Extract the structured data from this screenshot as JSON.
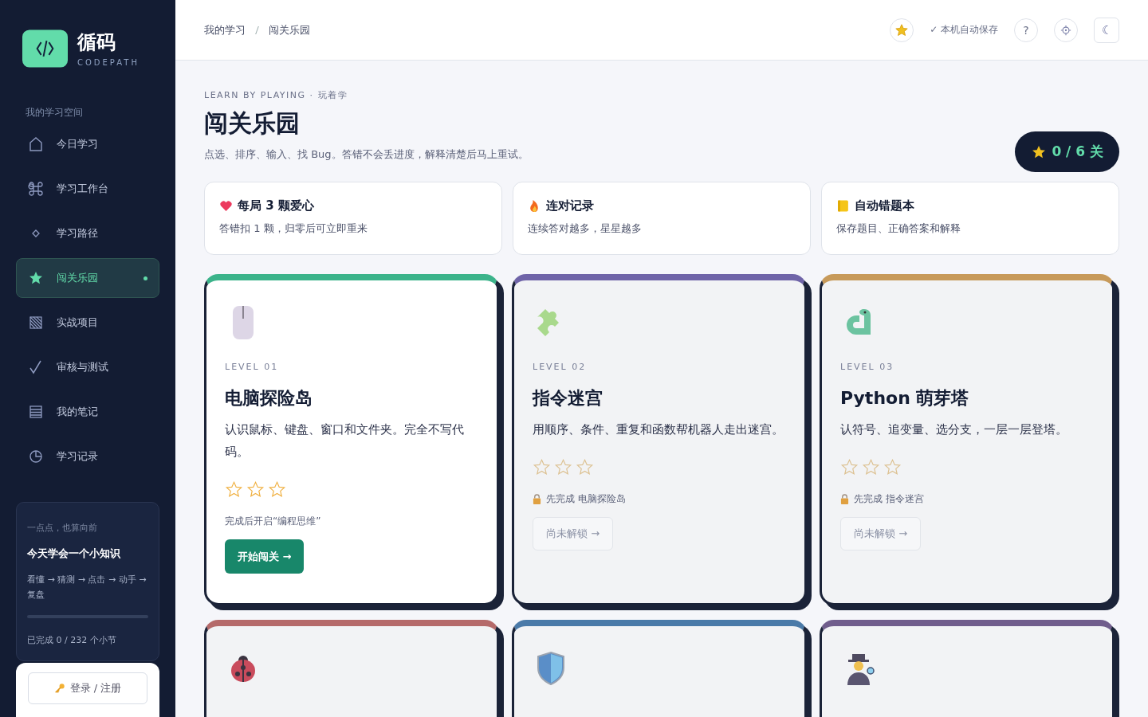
{
  "brand": {
    "name": "循码",
    "sub": "CODEPATH"
  },
  "sidebar": {
    "section": "我的学习空间",
    "items": [
      {
        "label": "今日学习",
        "selected": false
      },
      {
        "label": "学习工作台",
        "selected": false
      },
      {
        "label": "学习路径",
        "selected": false
      },
      {
        "label": "闯关乐园",
        "selected": true
      },
      {
        "label": "实战项目",
        "selected": false
      },
      {
        "label": "审核与测试",
        "selected": false
      },
      {
        "label": "我的笔记",
        "selected": false
      },
      {
        "label": "学习记录",
        "selected": false
      }
    ],
    "progress_card": {
      "eyebrow": "一点点，也算向前",
      "title": "今天学会一个小知识",
      "steps": "看懂 → 猜测 → 点击 → 动手 → 复盘",
      "level": 0,
      "caption": "已完成 0 / 232 个小节"
    },
    "login": "登录 / 注册"
  },
  "breadcrumb": [
    "我的学习",
    "闯关乐园"
  ],
  "header": {
    "saved": "✓ 本机自动保存",
    "help": "?",
    "theme": "☾"
  },
  "hero": {
    "eyebrow": "LEARN BY PLAYING · 玩着学",
    "title": "闯关乐园",
    "subtitle": "点选、排序、输入、找 Bug。答错不会丢进度，解释清楚后马上重试。",
    "score": "0 / 6 关"
  },
  "features": [
    {
      "title": "每局 3 颗爱心",
      "desc": "答错扣 1 颗，归零后可立即重来"
    },
    {
      "title": "连对记录",
      "desc": "连续答对越多，星星越多"
    },
    {
      "title": "自动错题本",
      "desc": "保存题目、正确答案和解释"
    }
  ],
  "levels": [
    {
      "level": "LEVEL 01",
      "title": "电脑探险岛",
      "desc": "认识鼠标、键盘、窗口和文件夹。完全不写代码。",
      "stars": 0,
      "locked": false,
      "color": "#3bb38a",
      "note": "完成后开启“编程思维”",
      "action": "开始闯关 →"
    },
    {
      "level": "LEVEL 02",
      "title": "指令迷宫",
      "desc": "用顺序、条件、重复和函数帮机器人走出迷宫。",
      "stars": 0,
      "locked": true,
      "color": "#6f64a8",
      "note": "先完成 电脑探险岛",
      "action": "尚未解锁 →"
    },
    {
      "level": "LEVEL 03",
      "title": "Python 萌芽塔",
      "desc": "认符号、追变量、选分支，一层一层登塔。",
      "stars": 0,
      "locked": true,
      "color": "#c79a5a",
      "note": "先完成 指令迷宫",
      "action": "尚未解锁 →"
    },
    {
      "locked": true,
      "color": "#b56a6a"
    },
    {
      "locked": true,
      "color": "#4a7aa8"
    },
    {
      "locked": true,
      "color": "#705d8c"
    }
  ]
}
